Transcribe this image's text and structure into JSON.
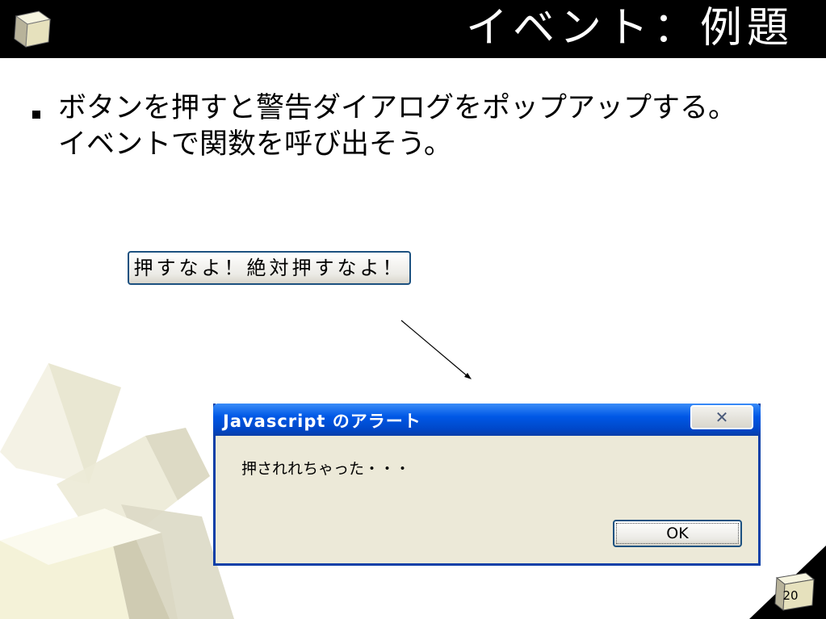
{
  "slide": {
    "title": "イベント：例題",
    "bullet_line1": "ボタンを押すと警告ダイアログをポップアップする。",
    "bullet_line2": "イベントで関数を呼び出そう。",
    "page_number": "20"
  },
  "demo_button": {
    "label": "押すなよ！絶対押すなよ！"
  },
  "alert_dialog": {
    "title": "Javascript のアラート",
    "close_symbol": "✕",
    "message": "押されれちゃった・・・",
    "ok_label": "OK"
  },
  "colors": {
    "title_bar": "#000000",
    "dialog_title_blue": "#0058e6",
    "dialog_body": "#ece9d8",
    "cube_cream": "#f2f0d6"
  }
}
